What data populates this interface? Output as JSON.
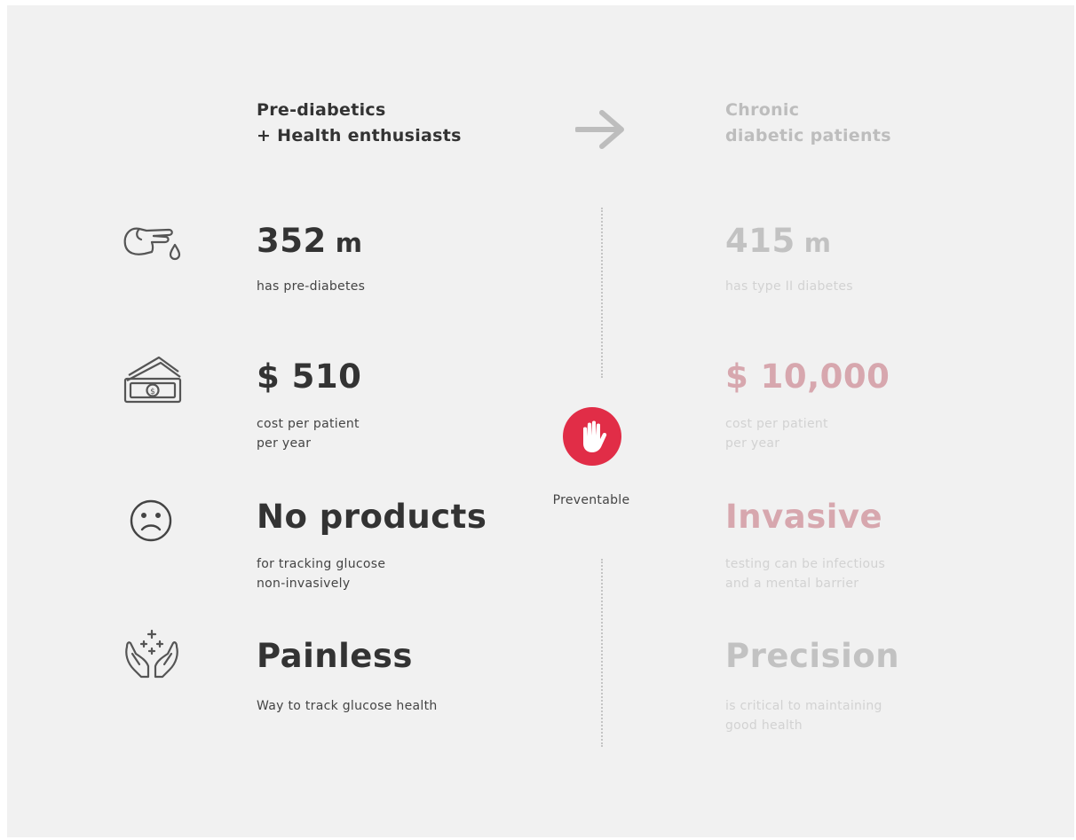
{
  "header": {
    "left_line1": "Pre-diabetics",
    "left_line2": "+ Health enthusiasts",
    "right_line1": "Chronic",
    "right_line2": "diabetic patients",
    "arrow_icon": "arrow-right-icon"
  },
  "left": [
    {
      "icon": "finger-blood-drop-icon",
      "value": "352",
      "unit": "m",
      "line1": "has pre-diabetes",
      "line2": ""
    },
    {
      "icon": "money-stack-icon",
      "value": "$ 510",
      "unit": "",
      "line1": "cost per patient",
      "line2": "per year"
    },
    {
      "icon": "sad-face-icon",
      "value": "No products",
      "unit": "",
      "line1": "for tracking glucose",
      "line2": "non-invasively"
    },
    {
      "icon": "caring-hands-icon",
      "value": "Painless",
      "unit": "",
      "line1": "Way to track glucose health",
      "line2": ""
    }
  ],
  "right": [
    {
      "value": "415",
      "unit": "m",
      "line1": "has type II diabetes",
      "line2": ""
    },
    {
      "value": "$ 10,000",
      "unit": "",
      "line1": "cost per patient",
      "line2": "per year"
    },
    {
      "value": "Invasive",
      "unit": "",
      "line1": "testing can be infectious",
      "line2": "and a mental barrier"
    },
    {
      "value": "Precision",
      "unit": "",
      "line1": "is critical to maintaining",
      "line2": "good health"
    }
  ],
  "center": {
    "badge_icon": "stop-hand-icon",
    "label": "Preventable"
  },
  "colors": {
    "background": "#f1f1f1",
    "dark_text": "#333333",
    "muted_text": "#c2c2c2",
    "pink_text": "#d7a7ae",
    "badge": "#e12d47"
  }
}
